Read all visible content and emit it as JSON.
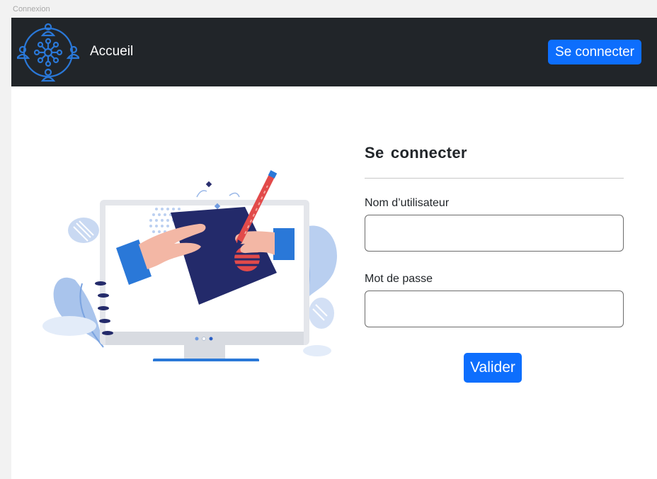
{
  "window": {
    "title": "Connexion"
  },
  "navbar": {
    "brand": "Accueil",
    "login_button": "Se connecter",
    "logo_icon": "network-people-icon"
  },
  "illustration": {
    "icon": "computer-signing-document-illustration"
  },
  "form": {
    "title": "Se  connecter",
    "username_label": "Nom d’utilisateur",
    "username_value": "",
    "password_label": "Mot de passe",
    "password_value": "",
    "submit_button": "Valider"
  },
  "colors": {
    "navbar_bg": "#212529",
    "accent": "#0d6efd",
    "page_bg": "#ffffff"
  }
}
